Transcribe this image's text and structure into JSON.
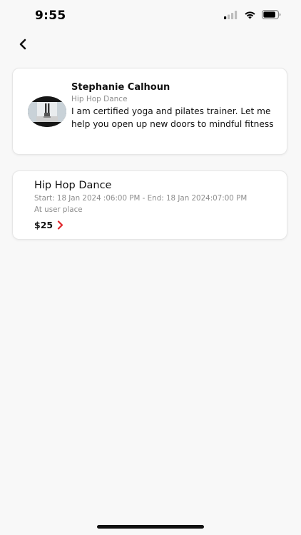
{
  "status_bar": {
    "time": "9:55"
  },
  "icons": {
    "back": "chevron-left-icon",
    "price_arrow": "chevron-right-icon",
    "signal": "cellular-signal-icon",
    "wifi": "wifi-icon",
    "battery": "battery-icon"
  },
  "colors": {
    "accent": "#e0262b",
    "secondary_text": "#8d8d8d",
    "background": "#f8f8f8"
  },
  "trainer": {
    "name": "Stephanie Calhoun",
    "category": "Hip Hop Dance",
    "bio": "I am certified yoga and pilates trainer. Let me help you open up new doors to mindful fitness"
  },
  "booking": {
    "title": "Hip Hop Dance",
    "time": "Start: 18 Jan 2024 :06:00 PM - End: 18 Jan 2024:07:00 PM",
    "location": "At user place",
    "price": "$25"
  }
}
